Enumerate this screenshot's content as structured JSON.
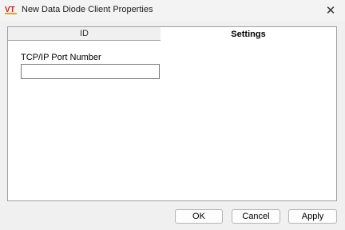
{
  "window": {
    "title": "New Data Diode Client Properties",
    "app_icon": "vt-logo-icon",
    "close_glyph": "✕"
  },
  "tabs": [
    {
      "label": "ID",
      "active": false
    },
    {
      "label": "Settings",
      "active": true
    }
  ],
  "settings": {
    "port_label": "TCP/IP Port Number",
    "port_value": ""
  },
  "buttons": {
    "ok": "OK",
    "cancel": "Cancel",
    "apply": "Apply"
  },
  "colors": {
    "accent_red": "#d42020",
    "accent_orange": "#f0a020"
  }
}
